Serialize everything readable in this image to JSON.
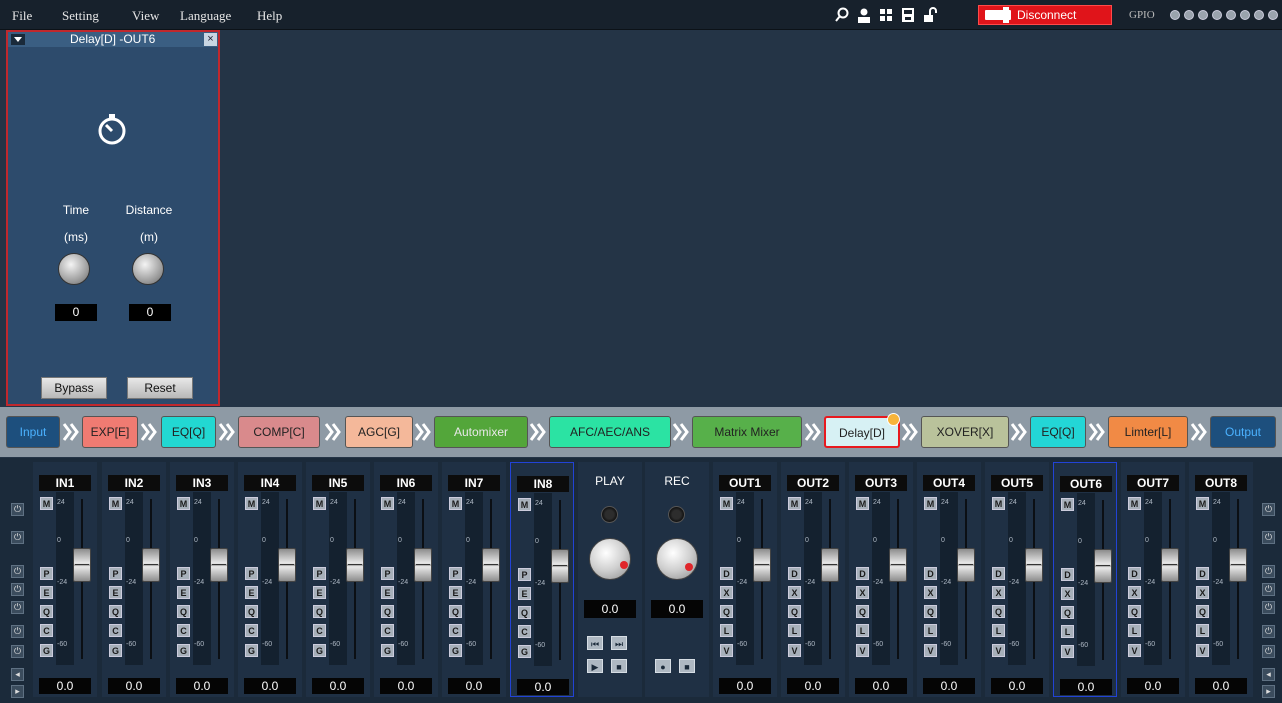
{
  "menu": [
    "File",
    "Setting",
    "View",
    "Language",
    "Help"
  ],
  "toolbar": {
    "icons": [
      "search-icon",
      "user-icon",
      "grid-icon",
      "save-icon",
      "lock-icon"
    ],
    "disconnect_label": "Disconnect",
    "gpio_label": "GPIO"
  },
  "panel": {
    "title": "Delay[D] -OUT6",
    "close": "×",
    "time_label": "Time",
    "time_unit": "(ms)",
    "distance_label": "Distance",
    "distance_unit": "(m)",
    "time_value": "0",
    "distance_value": "0",
    "bypass": "Bypass",
    "reset": "Reset"
  },
  "chain": [
    "Input",
    "EXP[E]",
    "EQ[Q]",
    "COMP[C]",
    "AGC[G]",
    "Automixer",
    "AFC/AEC/ANS",
    "Matrix Mixer",
    "Delay[D]",
    "XOVER[X]",
    "EQ[Q]",
    "Limter[L]",
    "Output"
  ],
  "meter_scale": [
    "24",
    "0",
    "-24",
    "-60"
  ],
  "inputs": [
    {
      "name": "IN1",
      "buttons": [
        "M",
        "P",
        "E",
        "Q",
        "C",
        "G"
      ],
      "value": "0.0"
    },
    {
      "name": "IN2",
      "buttons": [
        "M",
        "P",
        "E",
        "Q",
        "C",
        "G"
      ],
      "value": "0.0"
    },
    {
      "name": "IN3",
      "buttons": [
        "M",
        "P",
        "E",
        "Q",
        "C",
        "G"
      ],
      "value": "0.0"
    },
    {
      "name": "IN4",
      "buttons": [
        "M",
        "P",
        "E",
        "Q",
        "C",
        "G"
      ],
      "value": "0.0"
    },
    {
      "name": "IN5",
      "buttons": [
        "M",
        "P",
        "E",
        "Q",
        "C",
        "G"
      ],
      "value": "0.0"
    },
    {
      "name": "IN6",
      "buttons": [
        "M",
        "P",
        "E",
        "Q",
        "C",
        "G"
      ],
      "value": "0.0"
    },
    {
      "name": "IN7",
      "buttons": [
        "M",
        "P",
        "E",
        "Q",
        "C",
        "G"
      ],
      "value": "0.0"
    },
    {
      "name": "IN8",
      "buttons": [
        "M",
        "P",
        "E",
        "Q",
        "C",
        "G"
      ],
      "value": "0.0"
    }
  ],
  "play": {
    "label": "PLAY",
    "value": "0.0"
  },
  "rec": {
    "label": "REC",
    "value": "0.0"
  },
  "outputs": [
    {
      "name": "OUT1",
      "buttons": [
        "M",
        "D",
        "X",
        "Q",
        "L",
        "V"
      ],
      "value": "0.0"
    },
    {
      "name": "OUT2",
      "buttons": [
        "M",
        "D",
        "X",
        "Q",
        "L",
        "V"
      ],
      "value": "0.0"
    },
    {
      "name": "OUT3",
      "buttons": [
        "M",
        "D",
        "X",
        "Q",
        "L",
        "V"
      ],
      "value": "0.0"
    },
    {
      "name": "OUT4",
      "buttons": [
        "M",
        "D",
        "X",
        "Q",
        "L",
        "V"
      ],
      "value": "0.0"
    },
    {
      "name": "OUT5",
      "buttons": [
        "M",
        "D",
        "X",
        "Q",
        "L",
        "V"
      ],
      "value": "0.0"
    },
    {
      "name": "OUT6",
      "buttons": [
        "M",
        "D",
        "X",
        "Q",
        "L",
        "V"
      ],
      "value": "0.0"
    },
    {
      "name": "OUT7",
      "buttons": [
        "M",
        "D",
        "X",
        "Q",
        "L",
        "V"
      ],
      "value": "0.0"
    },
    {
      "name": "OUT8",
      "buttons": [
        "M",
        "D",
        "X",
        "Q",
        "L",
        "V"
      ],
      "value": "0.0"
    }
  ],
  "selected_strips": [
    "IN8",
    "OUT6"
  ],
  "colors": {
    "disconnect": "#e0141a",
    "panel_bg": "#2d4b6c",
    "selected_border": "#2243d6",
    "chain_colors": [
      "#1d4f7d",
      "#f07b72",
      "#22d8d2",
      "#d98a8c",
      "#f4b89a",
      "#53a63a",
      "#2be3a3",
      "#57b04a",
      "#d7f1f4",
      "#b9c29b",
      "#23d6d6",
      "#f18a45",
      "#1d4f7d"
    ]
  }
}
